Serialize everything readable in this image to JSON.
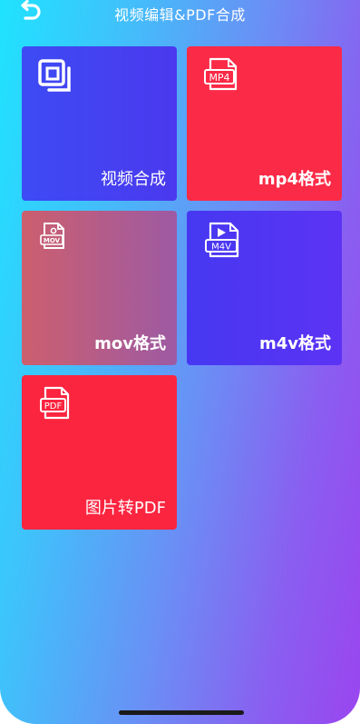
{
  "header": {
    "title": "视频编辑&PDF合成",
    "back_icon": "undo-arrow-icon"
  },
  "tiles": [
    {
      "label": "视频合成",
      "icon": "video-merge-icon",
      "color": "#4040F2"
    },
    {
      "label": "mp4格式",
      "icon": "mp4-file-icon",
      "color": "#FB2A46",
      "icon_text": "MP4"
    },
    {
      "label": "mov格式",
      "icon": "mov-file-icon",
      "color": "#B45D86",
      "icon_text": "MOV"
    },
    {
      "label": "m4v格式",
      "icon": "m4v-file-icon",
      "color": "#5036F3",
      "icon_text": "M4V"
    },
    {
      "label": "图片转PDF",
      "icon": "pdf-file-icon",
      "color": "#FB2540",
      "icon_text": "PDF"
    }
  ],
  "colors": {
    "background_start": "#1FE3FF",
    "background_end": "#9A45EF",
    "text": "#FFFFFF"
  }
}
